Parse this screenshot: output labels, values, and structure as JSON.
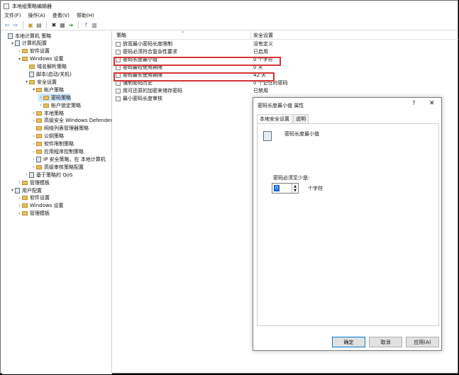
{
  "window": {
    "title": "本地组策略编辑器"
  },
  "menu": [
    "文件(F)",
    "操作(A)",
    "查看(V)",
    "帮助(H)"
  ],
  "toolbar": {
    "icons": [
      "back-arrow-icon",
      "forward-arrow-icon",
      "folder-up-icon",
      "console-tree-icon",
      "delete-icon",
      "properties-icon",
      "export-icon",
      "help-icon",
      "view-icon"
    ]
  },
  "tree": [
    {
      "label": "本地计算机 策略",
      "indent": 0,
      "twist": "",
      "icon": "computer"
    },
    {
      "label": "计算机配置",
      "indent": 1,
      "twist": "▾",
      "icon": "computer"
    },
    {
      "label": "软件设置",
      "indent": 2,
      "twist": "›",
      "icon": "folder"
    },
    {
      "label": "Windows 设置",
      "indent": 2,
      "twist": "▾",
      "icon": "folder"
    },
    {
      "label": "域名解析策略",
      "indent": 3,
      "twist": "",
      "icon": "folder"
    },
    {
      "label": "脚本(启动/关机)",
      "indent": 3,
      "twist": "",
      "icon": "script"
    },
    {
      "label": "安全设置",
      "indent": 3,
      "twist": "▾",
      "icon": "folder"
    },
    {
      "label": "帐户策略",
      "indent": 4,
      "twist": "▾",
      "icon": "folder"
    },
    {
      "label": "密码策略",
      "indent": 5,
      "twist": "›",
      "icon": "folder",
      "selected": true
    },
    {
      "label": "帐户锁定策略",
      "indent": 5,
      "twist": "›",
      "icon": "folder"
    },
    {
      "label": "本地策略",
      "indent": 4,
      "twist": "›",
      "icon": "folder"
    },
    {
      "label": "高级安全 Windows Defender 防",
      "indent": 4,
      "twist": "›",
      "icon": "folder"
    },
    {
      "label": "网络列表管理器策略",
      "indent": 4,
      "twist": "",
      "icon": "folder"
    },
    {
      "label": "公钥策略",
      "indent": 4,
      "twist": "›",
      "icon": "folder"
    },
    {
      "label": "软件限制策略",
      "indent": 4,
      "twist": "›",
      "icon": "folder"
    },
    {
      "label": "应用程序控制策略",
      "indent": 4,
      "twist": "›",
      "icon": "folder"
    },
    {
      "label": "IP 安全策略，在 本地计算机",
      "indent": 4,
      "twist": "›",
      "icon": "shield"
    },
    {
      "label": "高级审核策略配置",
      "indent": 4,
      "twist": "›",
      "icon": "folder"
    },
    {
      "label": "基于策略的 QoS",
      "indent": 3,
      "twist": "›",
      "icon": "chart"
    },
    {
      "label": "管理模板",
      "indent": 2,
      "twist": "›",
      "icon": "folder"
    },
    {
      "label": "用户配置",
      "indent": 1,
      "twist": "▾",
      "icon": "computer"
    },
    {
      "label": "软件设置",
      "indent": 2,
      "twist": "›",
      "icon": "folder"
    },
    {
      "label": "Windows 设置",
      "indent": 2,
      "twist": "›",
      "icon": "folder"
    },
    {
      "label": "管理模板",
      "indent": 2,
      "twist": "›",
      "icon": "folder"
    }
  ],
  "list": {
    "col_policy": "策略",
    "col_setting": "安全设置",
    "rows": [
      {
        "name": "放宽最小密码长度限制",
        "value": "没有定义"
      },
      {
        "name": "密码必须符合复杂性要求",
        "value": "已启用"
      },
      {
        "name": "密码长度最小值",
        "value": "0 个字符"
      },
      {
        "name": "密码最短使用期限",
        "value": "0 天"
      },
      {
        "name": "密码最长使用期限",
        "value": "42 天"
      },
      {
        "name": "强制密码历史",
        "value": "0 个记住的密码"
      },
      {
        "name": "用可还原的加密来储存密码",
        "value": "已禁用"
      },
      {
        "name": "最小密码长度审核",
        "value": ""
      }
    ]
  },
  "highlight_color": "#d93232",
  "dialog": {
    "title": "密码长度最小值 属性",
    "help": "?",
    "close": "✕",
    "tabs": [
      "本地安全设置",
      "说明"
    ],
    "policy_name": "密码长度最小值",
    "field_label": "密码必须至少是:",
    "value": "0",
    "unit": "个字符",
    "ok": "确定",
    "cancel": "取消",
    "apply": "应用(A)"
  }
}
